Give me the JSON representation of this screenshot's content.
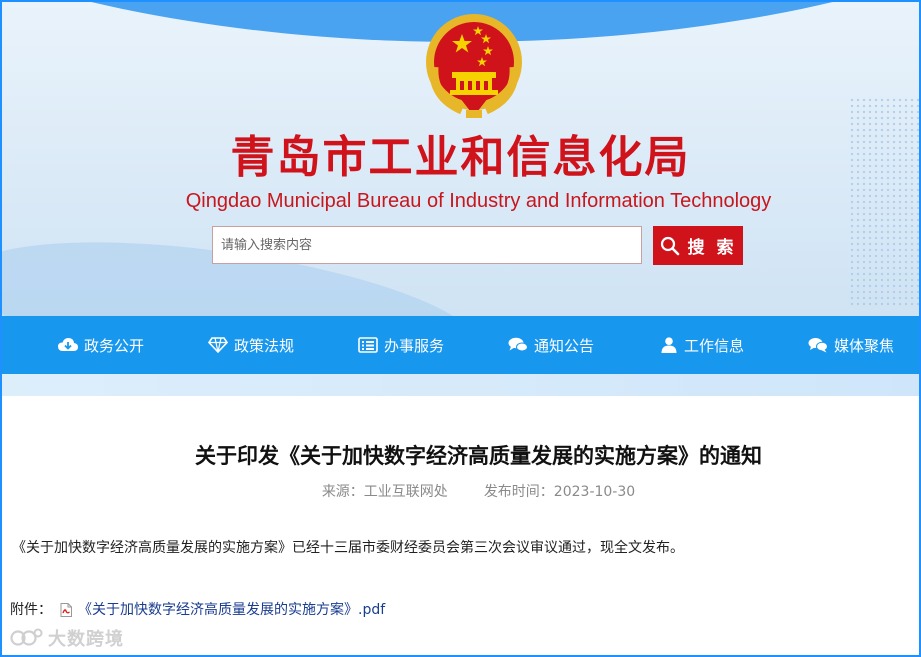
{
  "header": {
    "title_cn": "青岛市工业和信息化局",
    "title_en": "Qingdao Municipal Bureau of Industry and Information Technology",
    "emblem_icon": "national-emblem-icon",
    "brand_color": "#d0121b"
  },
  "search": {
    "placeholder": "请输入搜索内容",
    "value": "",
    "button_label": "搜 索"
  },
  "nav": {
    "background": "#1897ee",
    "items": [
      {
        "label": "政务公开",
        "icon": "cloud-download-icon"
      },
      {
        "label": "政策法规",
        "icon": "diamond-icon"
      },
      {
        "label": "办事服务",
        "icon": "list-icon"
      },
      {
        "label": "通知公告",
        "icon": "comments-icon"
      },
      {
        "label": "工作信息",
        "icon": "user-icon"
      },
      {
        "label": "媒体聚焦",
        "icon": "chat-bubbles-icon"
      }
    ]
  },
  "article": {
    "title": "关于印发《关于加快数字经济高质量发展的实施方案》的通知",
    "source": "来源：工业互联网处",
    "date": "发布时间：2023-10-30",
    "body": "《关于加快数字经济高质量发展的实施方案》已经十三届市委财经委员会第三次会议审议通过，现全文发布。",
    "attachment_label": "附件：",
    "attachment_link": "《关于加快数字经济高质量发展的实施方案》.pdf"
  },
  "watermark": {
    "text": "大数跨境"
  }
}
